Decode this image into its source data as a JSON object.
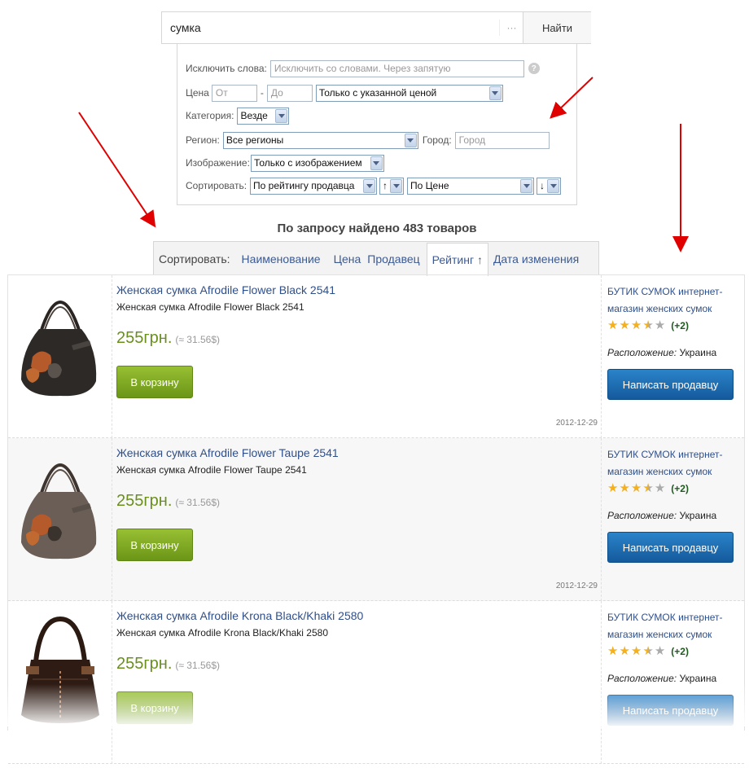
{
  "search": {
    "value": "сумка",
    "dots": "···",
    "button": "Найти"
  },
  "filters": {
    "exclude_label": "Исключить слова:",
    "exclude_placeholder": "Исключить со словами. Через запятую",
    "help": "?",
    "price_label": "Цена",
    "price_from": "От",
    "price_dash": "-",
    "price_to": "До",
    "price_mode": "Только с указанной ценой",
    "category_label": "Категория:",
    "category_value": "Везде",
    "region_label": "Регион:",
    "region_value": "Все регионы",
    "city_label": "Город:",
    "city_placeholder": "Город",
    "image_label": "Изображение:",
    "image_value": "Только с изображением",
    "sort_label": "Сортировать:",
    "sort1_value": "По рейтингу продавца",
    "sort1_dir": "↑",
    "sort2_value": "По Цене",
    "sort2_dir": "↓"
  },
  "results_title": "По запросу найдено 483 товаров",
  "sort_tabs": {
    "label": "Сортировать:",
    "name": "Наименование",
    "price": "Цена",
    "seller": "Продавец",
    "rating": "Рейтинг ↑",
    "date": "Дата изменения"
  },
  "items": [
    {
      "title": "Женская сумка Afrodile Flower Black 2541",
      "subtitle": "Женская сумка Afrodile Flower Black 2541",
      "price": "255грн.",
      "usd": "(≈ 31.56$)",
      "cart": "В корзину",
      "date": "2012-12-29",
      "seller_name": "БУТИК СУМОК",
      "seller_desc": "интернет-магазин женских сумок",
      "rating_plus": "(+2)",
      "location_label": "Расположение:",
      "location": "Украина",
      "message": "Написать продавцу"
    },
    {
      "title": "Женская сумка Afrodile Flower Taupe 2541",
      "subtitle": "Женская сумка Afrodile Flower Taupe 2541",
      "price": "255грн.",
      "usd": "(≈ 31.56$)",
      "cart": "В корзину",
      "date": "2012-12-29",
      "seller_name": "БУТИК СУМОК",
      "seller_desc": "интернет-магазин женских сумок",
      "rating_plus": "(+2)",
      "location_label": "Расположение:",
      "location": "Украина",
      "message": "Написать продавцу"
    },
    {
      "title": "Женская сумка Afrodile Krona Black/Khaki 2580",
      "subtitle": "Женская сумка Afrodile Krona Black/Khaki 2580",
      "price": "255грн.",
      "usd": "(≈ 31.56$)",
      "cart": "В корзину",
      "date": "",
      "seller_name": "БУТИК СУМОК",
      "seller_desc": "интернет-магазин женских сумок",
      "rating_plus": "(+2)",
      "location_label": "Расположение:",
      "location": "Украина",
      "message": "Написать продавцу"
    }
  ],
  "rating_stars": 3.5,
  "rating_max": 5,
  "colors": {
    "link": "#2f4f8a",
    "price": "#6a8f1c",
    "cart": "#7ba21d",
    "message": "#1d6cb3",
    "arrow": "#e00000"
  }
}
